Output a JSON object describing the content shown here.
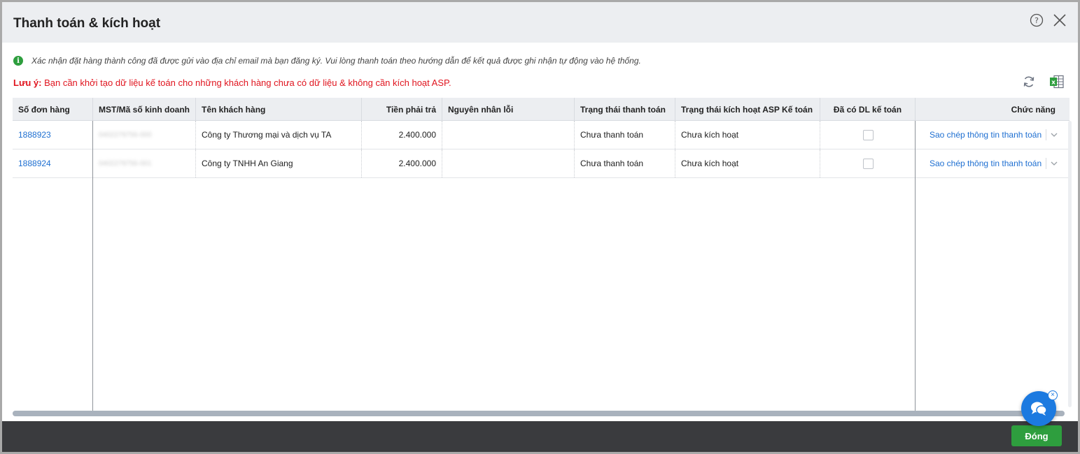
{
  "dialog": {
    "title": "Thanh toán & kích hoạt",
    "info_text": "Xác nhận đặt hàng thành công đã được gửi vào địa chỉ email mà bạn đăng ký. Vui lòng thanh toán theo hướng dẫn để kết quả được ghi nhận tự động vào hệ thống.",
    "note_label": "Lưu ý:",
    "note_text": " Bạn cần khởi tạo dữ liệu kế toán cho những khách hàng chưa có dữ liệu & không cần kích hoạt ASP.",
    "icons": [
      "help-icon",
      "close-icon",
      "info-icon",
      "refresh-icon",
      "excel-icon",
      "chat-icon"
    ],
    "colors": {
      "accent_green": "#2e9e3e",
      "link_blue": "#1e6fd1",
      "note_red": "#e0141e",
      "footer_dark": "#3a3b3e"
    }
  },
  "table": {
    "headers": {
      "order_no": "Số đơn hàng",
      "tax_code": "MST/Mã số kinh doanh",
      "customer": "Tên khách hàng",
      "amount": "Tiền phải trả",
      "error_reason": "Nguyên nhân lỗi",
      "payment_status": "Trạng thái thanh toán",
      "activation_status": "Trạng thái kích hoạt ASP Kế toán",
      "has_data": "Đã có DL kế toán",
      "actions": "Chức năng"
    },
    "rows": [
      {
        "order_no": "1888923",
        "tax_code": "0402279756-000",
        "customer": "Công ty Thương mại và dịch vụ TA",
        "amount": "2.400.000",
        "error_reason": "",
        "payment_status": "Chưa thanh toán",
        "activation_status": "Chưa kích hoạt",
        "action": "Sao chép thông tin thanh toán"
      },
      {
        "order_no": "1888924",
        "tax_code": "0402279756-001",
        "customer": "Công ty TNHH An Giang",
        "amount": "2.400.000",
        "error_reason": "",
        "payment_status": "Chưa thanh toán",
        "activation_status": "Chưa kích hoạt",
        "action": "Sao chép thông tin thanh toán"
      }
    ]
  },
  "footer": {
    "close_label": "Đóng"
  },
  "chat": {
    "close_label": "×"
  }
}
